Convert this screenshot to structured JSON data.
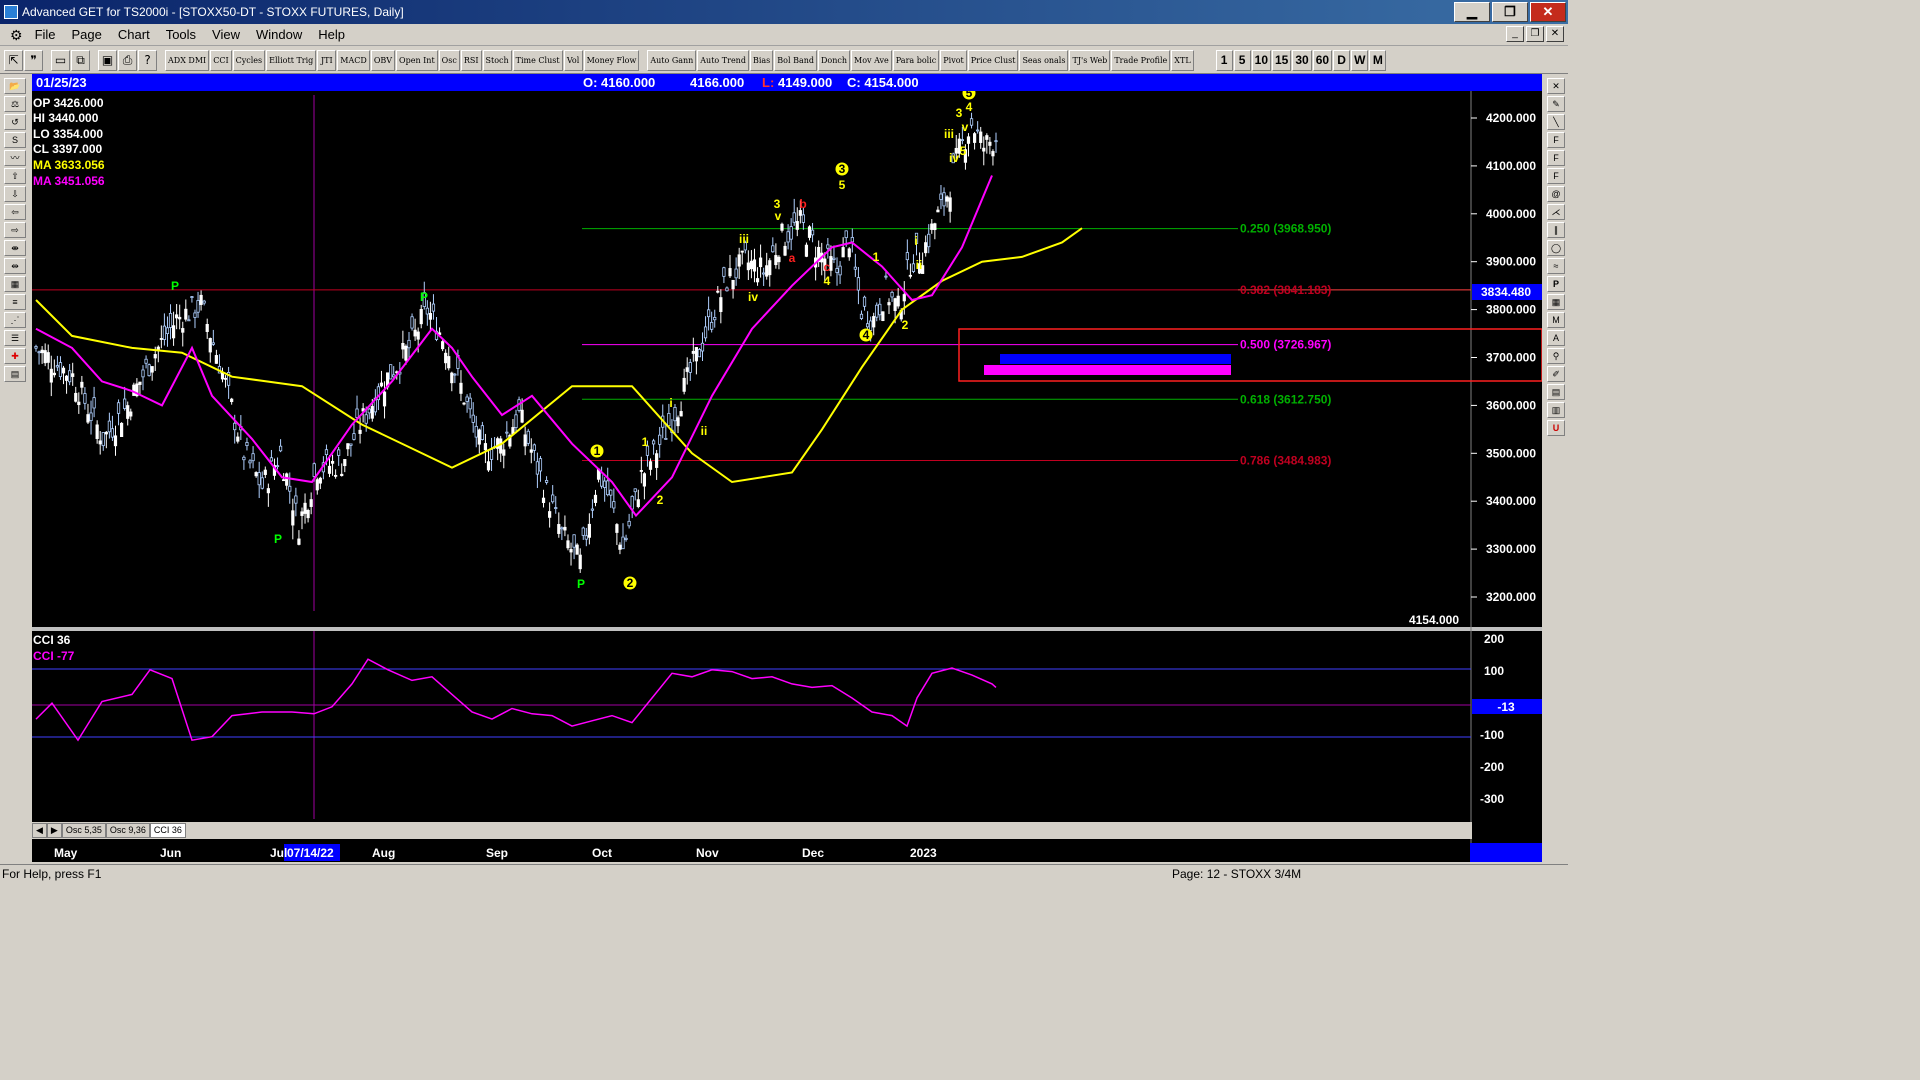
{
  "window": {
    "title": "Advanced GET for TS2000i - [STOXX50-DT - STOXX FUTURES, Daily]",
    "minimize": "▁",
    "maximize": "❐",
    "close": "✕"
  },
  "menu": [
    "File",
    "Page",
    "Chart",
    "Tools",
    "View",
    "Window",
    "Help"
  ],
  "toolbar": {
    "icons": [
      "pointer-icon",
      "quote-icon",
      "page-icon",
      "copy-icon",
      "save-icon",
      "print-icon",
      "help-icon"
    ],
    "studies": [
      "ADX DMI",
      "CCI",
      "Cycles",
      "Elliott Trig",
      "JTI",
      "MACD",
      "OBV",
      "Open Int",
      "Osc",
      "RSI",
      "Stoch",
      "Time Clust",
      "Vol",
      "Money Flow",
      "Auto Gann",
      "Auto Trend",
      "Bias",
      "Bol Band",
      "Donch",
      "Mov Ave",
      "Para bolic",
      "Pivot",
      "Price Clust",
      "Seas onals",
      "TJ's Web",
      "Trade Profile",
      "XTL"
    ],
    "periods": [
      "1",
      "5",
      "10",
      "15",
      "30",
      "60",
      "D",
      "W",
      "M"
    ]
  },
  "info_bar": {
    "date": "01/25/23",
    "open": "O: 4160.000",
    "high": "4166.000",
    "low_label": "L:",
    "low": "4149.000",
    "close": "C: 4154.000"
  },
  "cursor_readout": {
    "op": "OP  3426.000",
    "hi": "HI   3440.000",
    "lo": "LO   3354.000",
    "cl": "CL   3397.000",
    "ma1": "MA  3633.056",
    "ma2": "MA  3451.056"
  },
  "colors": {
    "background": "#000000",
    "up_candle": "#ffffff",
    "down_candle": "#b0d0ff",
    "ma_fast": "#ff00ff",
    "ma_slow": "#ffff00",
    "fib_green": "#00b000",
    "fib_red": "#c00020",
    "fib_magenta": "#ff00ff",
    "wave_yellow": "#ffff00",
    "wave_red": "#ff0000",
    "pivot_green": "#00ff00",
    "info_blue": "#0000ff"
  },
  "price_axis": {
    "labels": [
      "4200.000",
      "4100.000",
      "4000.000",
      "3900.000",
      "3800.000",
      "3700.000",
      "3600.000",
      "3500.000",
      "3400.000",
      "3300.000",
      "3200.000"
    ],
    "current_box": "3834.480",
    "last_value": "4154.000"
  },
  "fib_levels": [
    {
      "label": "0.250 (3968.950)",
      "value": 3968.95,
      "color": "#00b000"
    },
    {
      "label": "0.382 (3841.183)",
      "value": 3841.183,
      "color": "#c00020"
    },
    {
      "label": "0.500 (3726.967)",
      "value": 3726.967,
      "color": "#ff00ff"
    },
    {
      "label": "0.618 (3612.750)",
      "value": 3612.75,
      "color": "#00b000"
    },
    {
      "label": "0.786 (3484.983)",
      "value": 3484.983,
      "color": "#c00020"
    }
  ],
  "cci_panel": {
    "title": "CCI 36",
    "value_label": "CCI  -77",
    "current_box": "-13",
    "axis": [
      "200",
      "100",
      "-100",
      "-200",
      "-300"
    ]
  },
  "wave_labels": {
    "yellow_circled": [
      "1",
      "2",
      "3",
      "4",
      "5"
    ],
    "yellow": [
      "1",
      "2",
      "1",
      "2",
      "3",
      "v",
      "iii",
      "iv",
      "ii",
      "i",
      "5",
      "4",
      "1",
      "2",
      "i",
      "ii",
      "iii",
      "iv",
      "v",
      "3",
      "4",
      "5",
      "iii",
      "ii"
    ],
    "red": [
      "b",
      "a",
      "c"
    ],
    "pivots": [
      "P",
      "P",
      "P",
      "P"
    ]
  },
  "tabs": [
    "Osc 5,35",
    "Osc 9,36",
    "CCI 36"
  ],
  "time_axis": {
    "months": [
      "May",
      "Jun",
      "Jul",
      "Aug",
      "Sep",
      "Oct",
      "Nov",
      "Dec",
      "2023"
    ],
    "cursor_date": "07/14/22"
  },
  "status": {
    "left": "For Help, press F1",
    "right": "Page: 12 - STOXX 3/4M"
  }
}
